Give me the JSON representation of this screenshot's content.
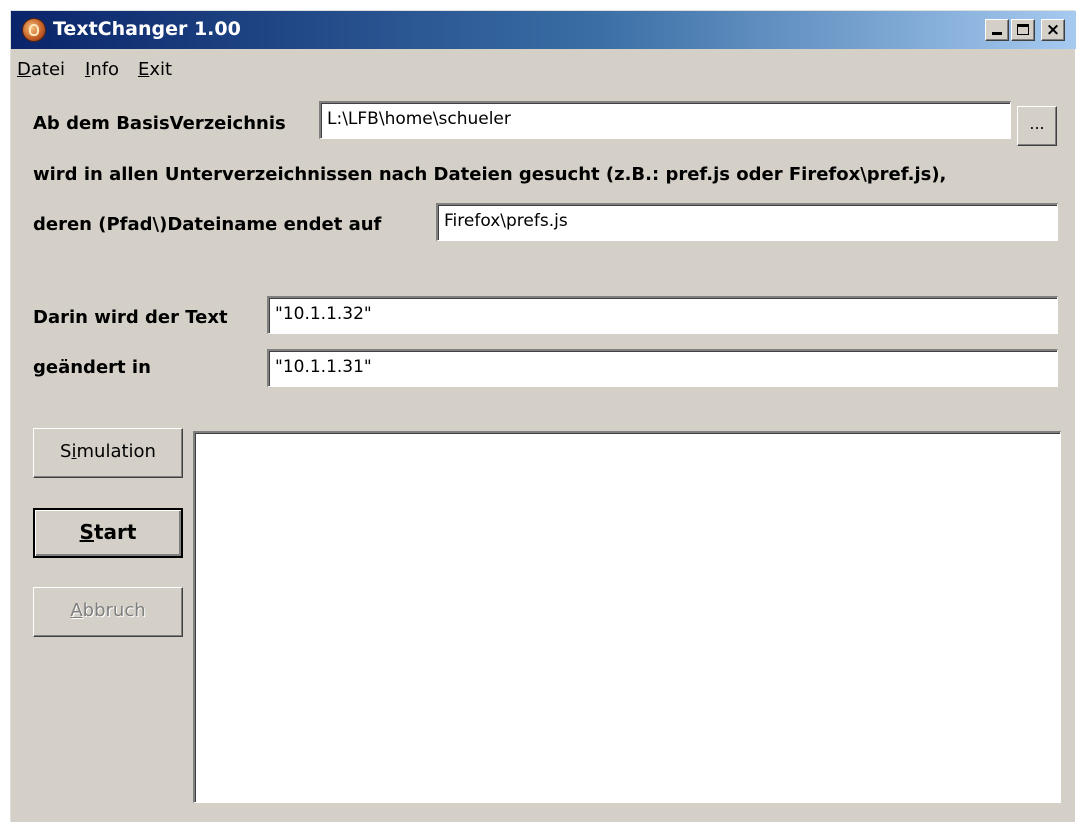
{
  "window": {
    "title": "TextChanger 1.00",
    "controls": {
      "minimize": "_",
      "maximize": "□",
      "close": "×"
    }
  },
  "menu": {
    "items": [
      {
        "label_first": "D",
        "label_rest": "atei"
      },
      {
        "label_first": "I",
        "label_rest": "nfo"
      },
      {
        "label_first": "E",
        "label_rest": "xit"
      }
    ]
  },
  "form": {
    "base_dir_label": "Ab dem BasisVerzeichnis",
    "base_dir_value": "L:\\LFB\\home\\schueler",
    "browse_label": "...",
    "search_desc": "wird in allen Unterverzeichnissen nach Dateien gesucht (z.B.: pref.js oder Firefox\\pref.js),",
    "filename_label": "deren (Pfad\\)Dateiname endet auf",
    "filename_value": "Firefox\\prefs.js",
    "search_text_label": "Darin wird der Text",
    "search_text_value": "\"10.1.1.32\"",
    "replace_text_label": "geändert in",
    "replace_text_value": "\"10.1.1.31\""
  },
  "buttons": {
    "simulation": {
      "before": "S",
      "underlined": "i",
      "after": "mulation"
    },
    "start": {
      "before": "",
      "underlined": "S",
      "after": "tart"
    },
    "abort": {
      "before": "",
      "underlined": "A",
      "after": "bbruch"
    }
  },
  "log": {
    "content": ""
  }
}
